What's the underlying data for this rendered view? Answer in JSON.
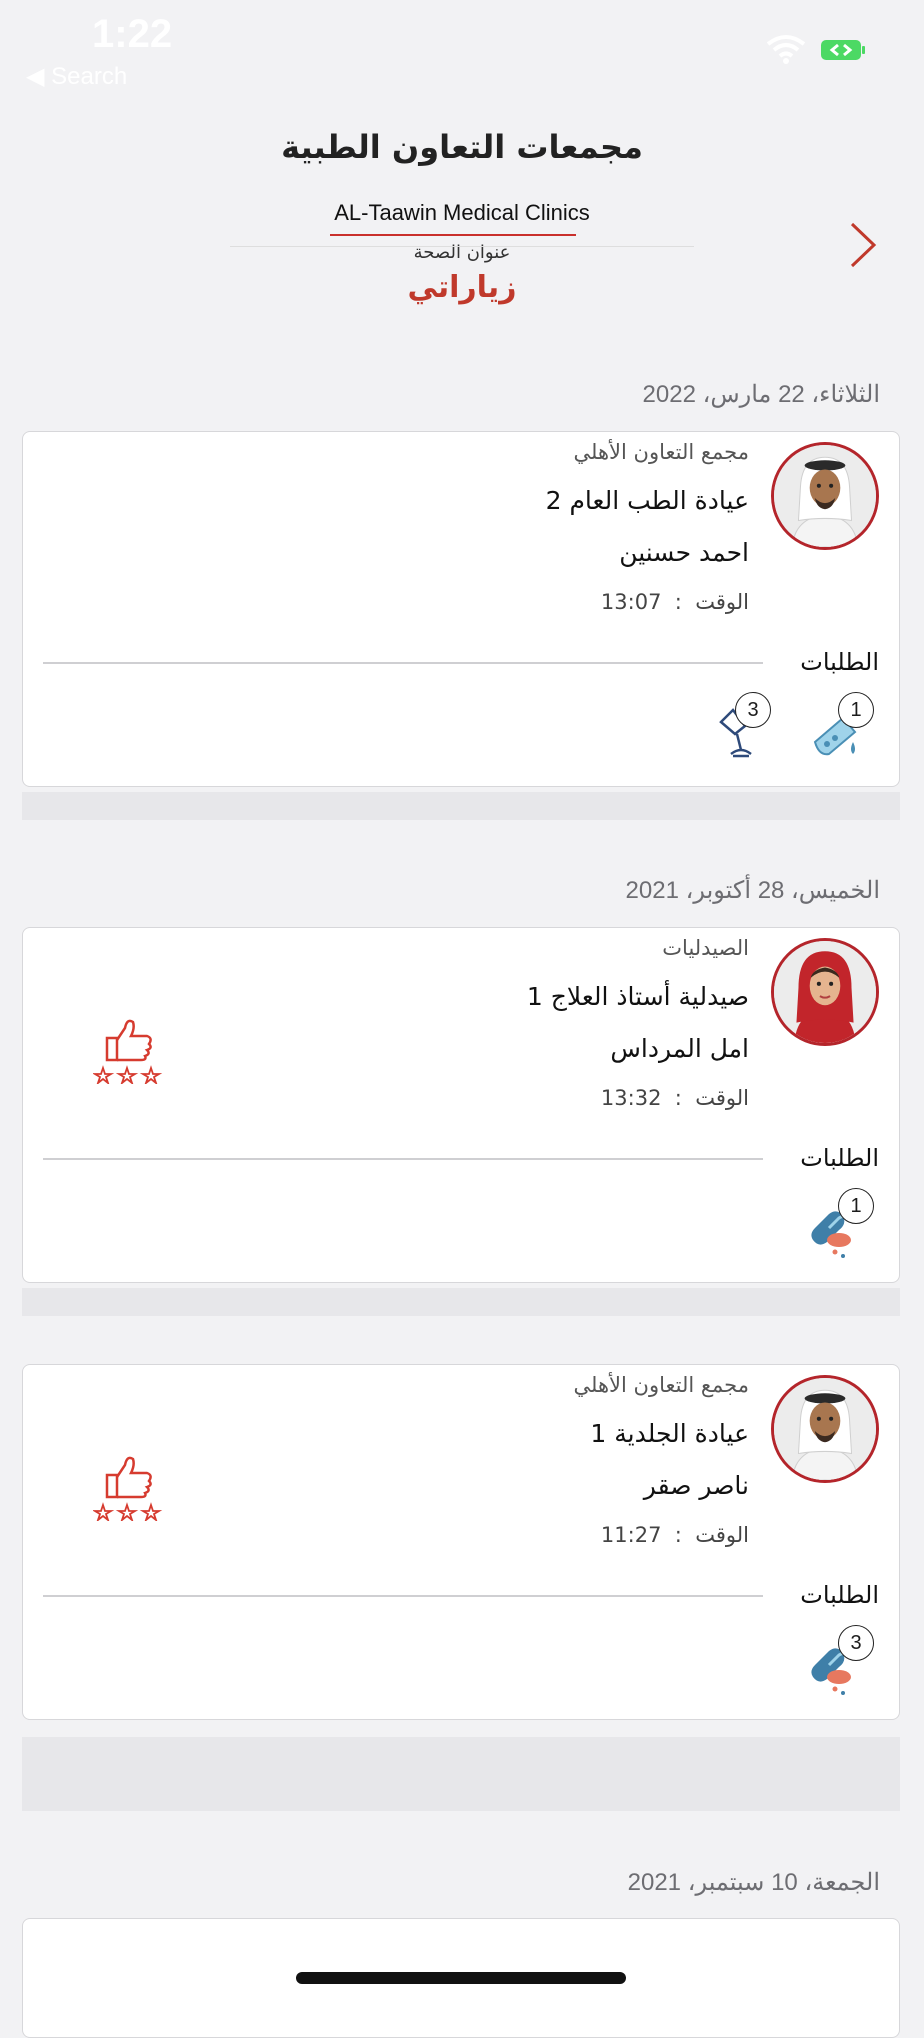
{
  "status_bar": {
    "time": "1:22",
    "back_label": "◀ Search"
  },
  "header": {
    "logo_ar": "مجمعات التعاون الطبية",
    "logo_en": "AL-Taawin Medical Clinics",
    "logo_sub": "عنوان الصحة",
    "title": "زياراتي"
  },
  "dates": {
    "d1": "الثلاثاء، 22 مارس، 2022",
    "d2": "الخميس، 28 أكتوبر، 2021",
    "d3": "الجمعة، 10 سبتمبر، 2021"
  },
  "labels": {
    "time_label": "الوقت",
    "requests_label": "الطلبات"
  },
  "visits": [
    {
      "facility": "مجمع التعاون الأهلي",
      "clinic": "عيادة الطب العام 2",
      "doctor": "احمد حسنين",
      "time": "13:07",
      "avatar": "male-doctor-avatar",
      "rated": false,
      "requests": [
        {
          "icon": "lab-test-icon",
          "count": "1"
        },
        {
          "icon": "radiology-icon",
          "count": "3"
        }
      ]
    },
    {
      "facility": "الصيدليات",
      "clinic": "صيدلية أستاذ العلاج 1",
      "doctor": "امل المرداس",
      "time": "13:32",
      "avatar": "female-doctor-avatar",
      "rated": true,
      "requests": [
        {
          "icon": "pills-icon",
          "count": "1"
        }
      ]
    },
    {
      "facility": "مجمع التعاون الأهلي",
      "clinic": "عيادة الجلدية 1",
      "doctor": "ناصر صقر",
      "time": "11:27",
      "avatar": "male-doctor-avatar",
      "rated": true,
      "requests": [
        {
          "icon": "pills-icon",
          "count": "3"
        }
      ]
    }
  ],
  "colors": {
    "accent": "#c0392b",
    "avatar_ring": "#b4252b",
    "background": "#f2f2f4"
  }
}
